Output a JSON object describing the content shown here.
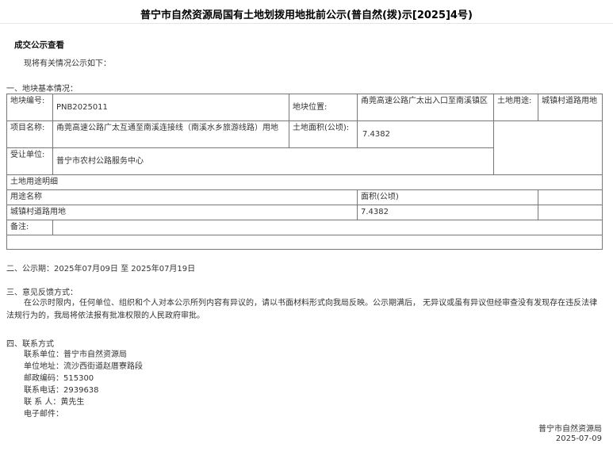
{
  "title": "普宁市自然资源局国有土地划拨用地批前公示(普自然(拨)示[2025]4号)",
  "section_head": "成交公示查看",
  "intro": "现将有关情况公示如下：",
  "section1": "一、地块基本情况：",
  "table": {
    "parcel_no_label": "地块编号:",
    "parcel_no": "PNB2025011",
    "location_label": "地块位置:",
    "location": "甬莞高速公路广太出入口至南溪镇区",
    "land_use_label": "土地用途:",
    "land_use": "城镇村道路用地",
    "project_label": "项目名称:",
    "project": "甬莞高速公路广太互通至南溪连接线（南溪水乡旅游线路）用地",
    "area_label": "土地面积(公顷):",
    "area": "7.4382",
    "recipient_label": "受让单位:",
    "recipient": "普宁市农村公路服务中心",
    "detail_header": "土地用途明细",
    "col_use": "用途名称",
    "col_area": "面积(公顷)",
    "row_use": "城镇村道路用地",
    "row_area": "7.4382",
    "remark_label": "备注:",
    "remark": ""
  },
  "period": "二、公示期：2025年07月09日 至 2025年07月19日",
  "section3": "三、意见反馈方式：",
  "feedback": "在公示时限内，任何单位、组织和个人对本公示所列内容有异议的，请以书面材料形式向我局反映。公示期满后， 无异议或虽有异议但经审查没有发现存在违反法律法规行为的，我局将依法报有批准权限的人民政府审批。",
  "section4": "四、联系方式",
  "contact": {
    "unit": "联系单位：普宁市自然资源局",
    "address": "单位地址：流沙西街道赵厝寮路段",
    "postcode": "邮政编码：515300",
    "phone": "联系电话：2939638",
    "person": "联 系 人：黄先生",
    "email": "电子邮件："
  },
  "signature": {
    "org": "普宁市自然资源局",
    "date": "2025-07-09"
  }
}
